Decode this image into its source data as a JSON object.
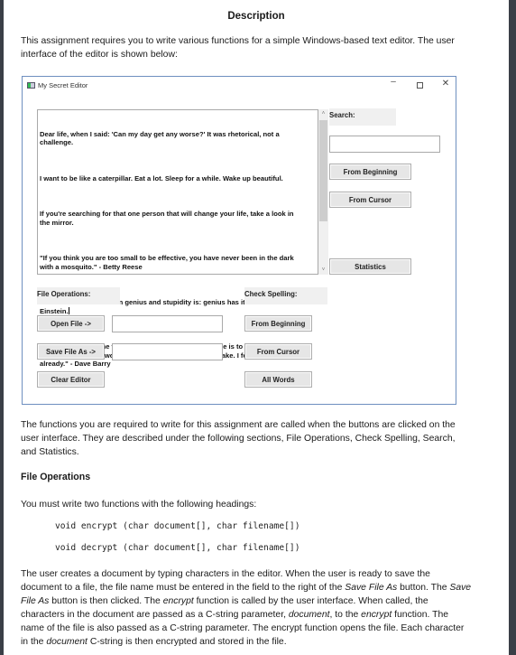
{
  "document": {
    "title": "Description",
    "intro": "This assignment requires you to write various functions for a simple Windows-based text editor. The user interface of the editor is shown below:",
    "paragraph_functions": "The functions you are required to write for this assignment are called when the buttons are clicked on the user interface. They are described under the following sections, File Operations, Check Spelling, Search, and Statistics.",
    "section_file_operations": "File Operations",
    "headings_intro": "You must write two functions with the following headings:",
    "code_lines": [
      "void encrypt (char document[], char filename[])",
      "void decrypt (char document[], char filename[])"
    ],
    "paragraph_user": {
      "p1": "The user creates a document by typing characters in the editor. When the user is ready to save the document to a file, the file name must be entered in the field to the right of the ",
      "em1": "Save File As",
      "p2": " button. The ",
      "em2": "Save File As",
      "p3": " button is then clicked. The ",
      "em3": "encrypt",
      "p4": " function is called by the user interface. When called, the characters in the document are passed as a C-string parameter, ",
      "em4": "document",
      "p5": ", to the ",
      "em5": "encrypt",
      "p6": " function. The name of the file is also passed as a C-string parameter. The encrypt function opens the file.  Each character in the ",
      "em6": "document",
      "p7": " C-string is then encrypted and stored in the file."
    }
  },
  "window": {
    "title": "My Secret Editor",
    "controls": {
      "minimize": "–",
      "close": "✕"
    },
    "editor_paragraphs": [
      "Dear life, when I said: 'Can my day get any worse?' It was rhetorical, not a challenge.",
      "I want to be like a caterpillar. Eat a lot. Sleep for a while. Wake up beautiful.",
      "If you're searching for that one person that will change your life, take a look in the mirror.",
      "\"If you think you are too small to be effective, you have never been in the dark with a mosquito.\" - Betty Reese",
      "\"The difference betweeen genius and stupidity is: genius has its limits.\" - Albert Einstein.",
      "\"My therapist told me the way to achieve true inner peace is to finish what I start. So far I've finished two bags of M&Ms and a chocolate cake. I feel better already.\" - Dave Barry"
    ],
    "scroll": {
      "up": "˄",
      "down": "˅"
    },
    "search": {
      "label": "Search:",
      "input_value": "",
      "from_beginning": "From Beginning",
      "from_cursor": "From Cursor"
    },
    "statistics_button": "Statistics",
    "file_operations": {
      "label": "File Operations:",
      "open_file": "Open File ->",
      "open_file_input": "",
      "save_file_as": "Save File As ->",
      "save_file_input": "",
      "clear_editor": "Clear Editor"
    },
    "check_spelling": {
      "label": "Check Spelling:",
      "from_beginning": "From Beginning",
      "from_cursor": "From Cursor",
      "all_words": "All Words"
    }
  }
}
